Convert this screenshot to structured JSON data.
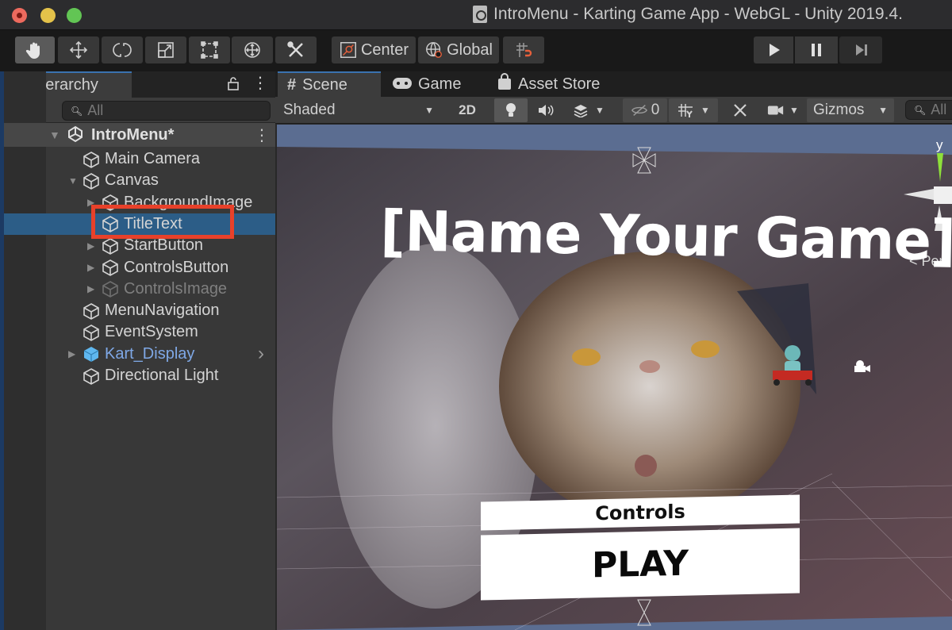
{
  "window": {
    "title": "IntroMenu - Karting Game App - WebGL - Unity 2019.4.",
    "traffic_lights": [
      "close",
      "minimize",
      "zoom"
    ]
  },
  "toolbar": {
    "tools": [
      {
        "name": "hand-tool",
        "icon": "hand-icon",
        "active": true
      },
      {
        "name": "move-tool",
        "icon": "move-arrows-icon",
        "active": false
      },
      {
        "name": "rotate-tool",
        "icon": "rotate-icon",
        "active": false
      },
      {
        "name": "scale-tool",
        "icon": "scale-icon",
        "active": false
      },
      {
        "name": "rect-tool",
        "icon": "rect-transform-icon",
        "active": false
      },
      {
        "name": "transform-tool",
        "icon": "transform-icon",
        "active": false
      },
      {
        "name": "custom-tool",
        "icon": "tools-icon",
        "active": false
      }
    ],
    "pivot_label": "Center",
    "space_label": "Global",
    "snap_icon": "grid-snap-icon",
    "play_controls": [
      "play",
      "pause",
      "step"
    ]
  },
  "hierarchy": {
    "tab_label": "Hierarchy",
    "search_placeholder": "All",
    "add_label": "+",
    "scene_name": "IntroMenu*",
    "items": [
      {
        "label": "Main Camera",
        "depth": 1,
        "expandable": false,
        "state": "normal"
      },
      {
        "label": "Canvas",
        "depth": 1,
        "expandable": true,
        "expanded": true,
        "state": "normal"
      },
      {
        "label": "BackgroundImage",
        "depth": 2,
        "expandable": true,
        "state": "normal"
      },
      {
        "label": "TitleText",
        "depth": 2,
        "expandable": false,
        "state": "selected"
      },
      {
        "label": "StartButton",
        "depth": 2,
        "expandable": true,
        "state": "normal"
      },
      {
        "label": "ControlsButton",
        "depth": 2,
        "expandable": true,
        "state": "normal"
      },
      {
        "label": "ControlsImage",
        "depth": 2,
        "expandable": true,
        "state": "inactive"
      },
      {
        "label": "MenuNavigation",
        "depth": 1,
        "expandable": false,
        "state": "normal"
      },
      {
        "label": "EventSystem",
        "depth": 1,
        "expandable": false,
        "state": "normal"
      },
      {
        "label": "Kart_Display",
        "depth": 1,
        "expandable": true,
        "state": "prefab"
      },
      {
        "label": "Directional Light",
        "depth": 1,
        "expandable": false,
        "state": "normal"
      }
    ],
    "highlight_color": "#e8412a"
  },
  "scene_tabs": [
    {
      "label": "Scene",
      "icon": "grid-hash-icon",
      "active": true
    },
    {
      "label": "Game",
      "icon": "gamepad-icon",
      "active": false
    },
    {
      "label": "Asset Store",
      "icon": "shopping-bag-icon",
      "active": false
    }
  ],
  "scene_toolbar": {
    "shading_mode": "Shaded",
    "mode_2d": "2D",
    "hidden_count": "0",
    "gizmos_label": "Gizmos",
    "search_placeholder": "All"
  },
  "viewport": {
    "title_text": "[Name Your Game]",
    "controls_button": "Controls",
    "play_button": "PLAY",
    "gizmo_axis_label": "y",
    "projection_label": "< Per"
  }
}
